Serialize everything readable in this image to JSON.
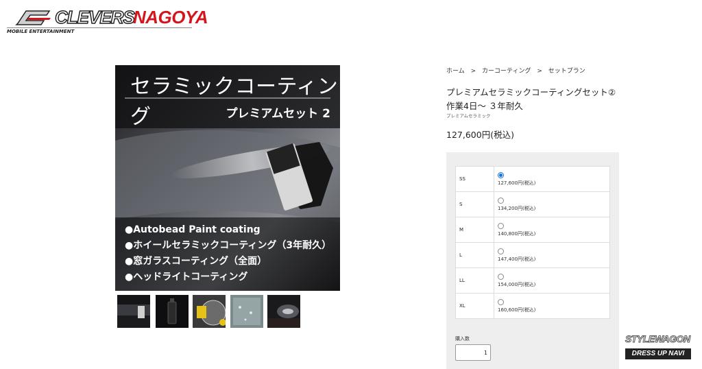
{
  "header": {
    "logo_primary": "CLEVERS",
    "logo_secondary": "NAGOYA",
    "logo_subtitle": "MOBILE ENTERTAINMENT"
  },
  "product_image": {
    "title": "セラミックコーティング",
    "subtitle": "プレミアムセット 2",
    "features": [
      "●Autobead Paint coating",
      "●ホイールセラミックコーティング（3年耐久）",
      "●窓ガラスコーティング（全面）",
      "●ヘッドライトコーティング"
    ]
  },
  "thumbnails": [
    "thumb-1",
    "thumb-2",
    "thumb-3",
    "thumb-4",
    "thumb-5"
  ],
  "breadcrumb": {
    "items": [
      "ホーム",
      "カーコーティング",
      "セットプラン"
    ],
    "separator": ">"
  },
  "product": {
    "title_line1": "プレミアムセラミックコーティングセット②",
    "title_line2": "作業4日〜 ３年耐久",
    "category": "プレミアムセラミック",
    "price": "127,600円(税込)"
  },
  "options": [
    {
      "size": "SS",
      "price": "127,600円(税込)",
      "selected": true
    },
    {
      "size": "S",
      "price": "134,200円(税込)",
      "selected": false
    },
    {
      "size": "M",
      "price": "140,800円(税込)",
      "selected": false
    },
    {
      "size": "L",
      "price": "147,400円(税込)",
      "selected": false
    },
    {
      "size": "LL",
      "price": "154,000円(税込)",
      "selected": false
    },
    {
      "size": "XL",
      "price": "160,600円(税込)",
      "selected": false
    }
  ],
  "quantity": {
    "label": "購入数",
    "value": "1"
  },
  "watermark": {
    "line1": "STYLEWAGON",
    "line2": "DRESS UP NAVI"
  },
  "colors": {
    "brand_red": "#d4161c",
    "radio_selected": "#1a6fe0",
    "panel_bg": "#eeeeee"
  }
}
